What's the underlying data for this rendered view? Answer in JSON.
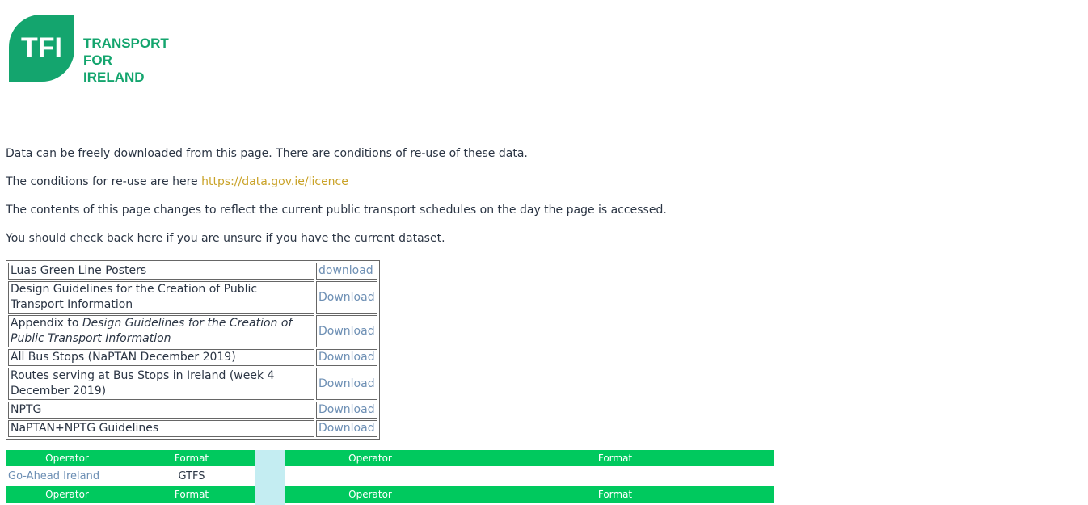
{
  "logo": {
    "badge": "TFI",
    "line1": "TRANSPORT",
    "line2": "FOR",
    "line3": "IRELAND"
  },
  "intro": {
    "p1": "Data can be freely downloaded from this page. There are conditions of re-use of these data.",
    "p2_prefix": "The conditions for re-use are here ",
    "p2_link": "https://data.gov.ie/licence",
    "p3": "The contents of this page changes to reflect the current public transport schedules on the day the page is accessed.",
    "p4": "You should check back here if you are unsure if you have the current dataset."
  },
  "files": [
    {
      "name": "Luas Green Line Posters",
      "link": "download"
    },
    {
      "name": "Design Guidelines for the Creation of Public Transport Information",
      "link": "Download"
    },
    {
      "name_prefix": "Appendix to ",
      "name_italic": "Design Guidelines for the Creation of Public Transport Information",
      "link": "Download"
    },
    {
      "name": "All Bus Stops (NaPTAN December 2019)",
      "link": "Download"
    },
    {
      "name": "Routes serving at Bus Stops in Ireland (week 4 December 2019)",
      "link": "Download"
    },
    {
      "name": "NPTG",
      "link": "Download"
    },
    {
      "name": "NaPTAN+NPTG Guidelines",
      "link": "Download"
    }
  ],
  "operators": {
    "headers": [
      "Operator",
      "Format",
      "Operator",
      "Format"
    ],
    "rows": [
      {
        "operator": "Go-Ahead Ireland",
        "format": "GTFS"
      }
    ]
  }
}
